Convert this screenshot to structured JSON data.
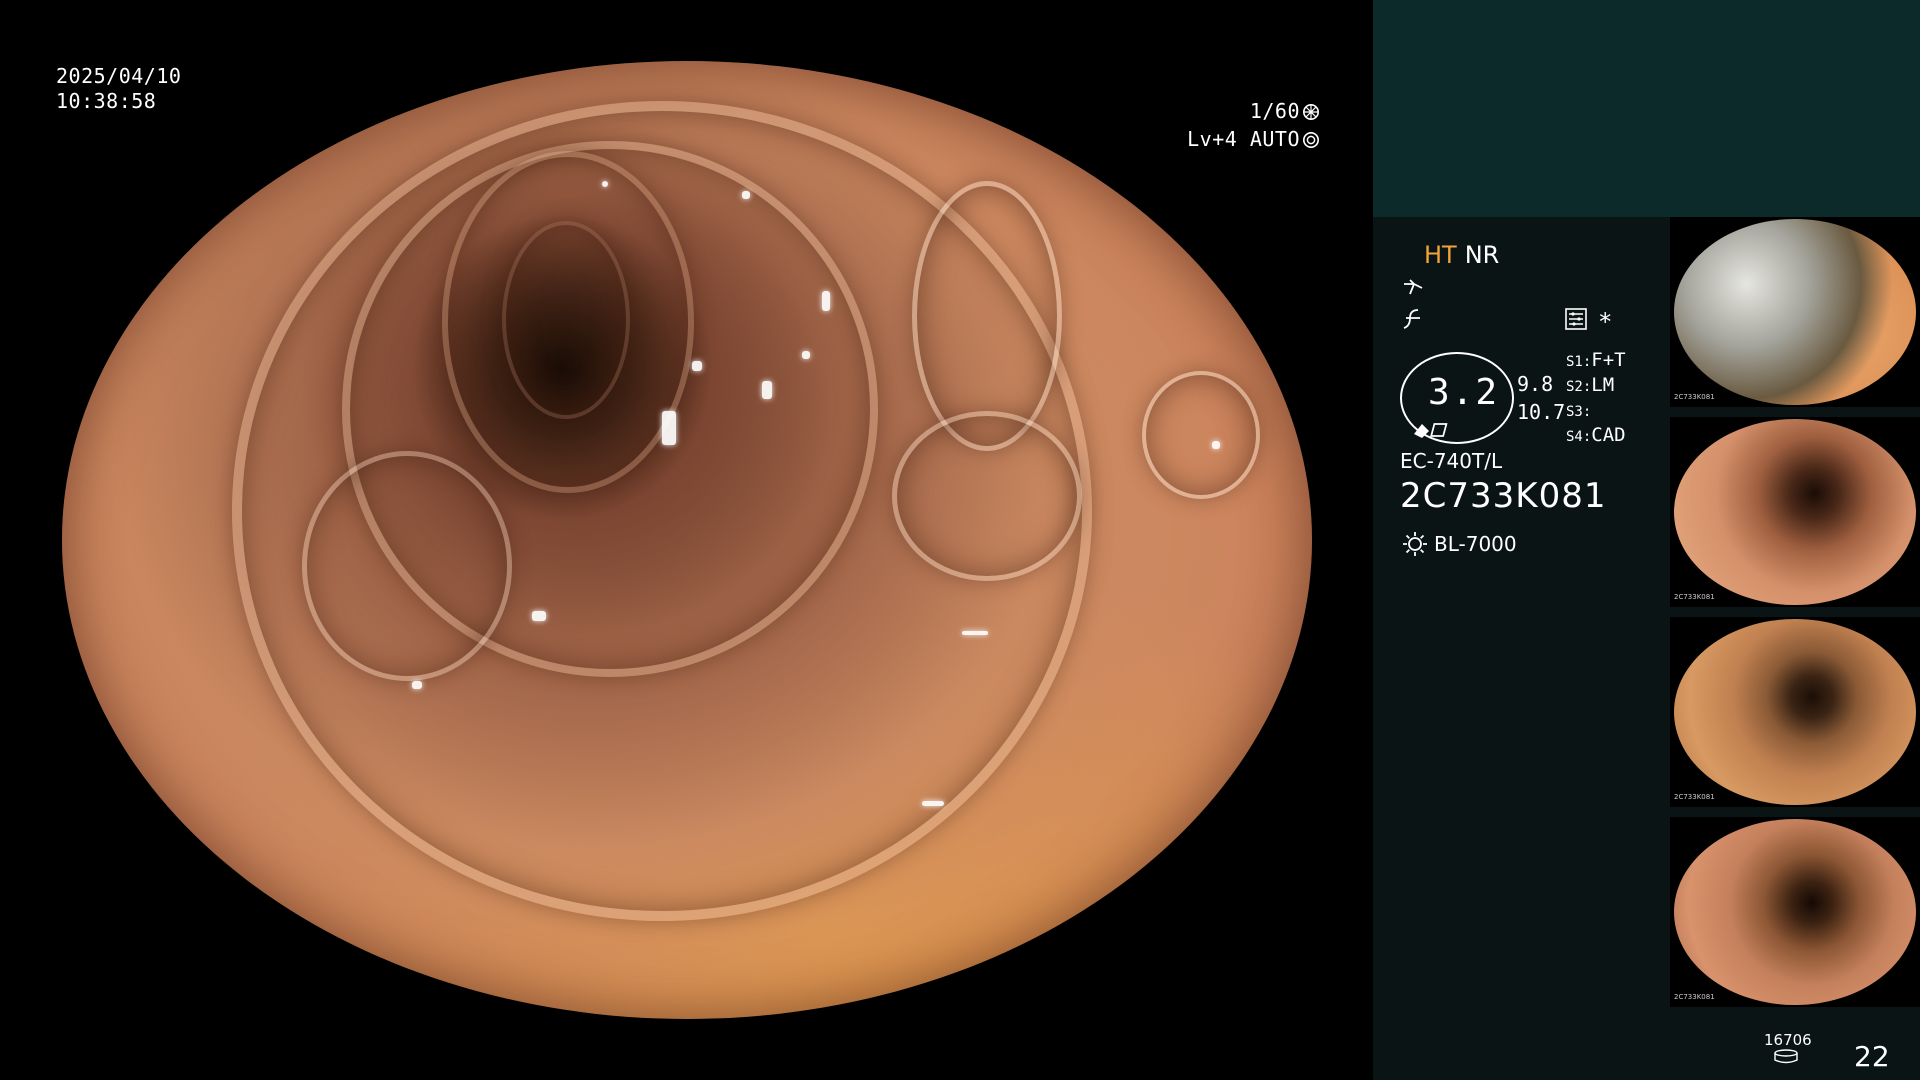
{
  "overlay": {
    "date": "2025/04/10",
    "time": "10:38:58",
    "shutter": "1/60",
    "brightness_level": "Lv+4",
    "iris_mode": "AUTO"
  },
  "panel": {
    "mode_ht": "HT",
    "mode_nr": "NR",
    "magnification": "3.2",
    "mag_a": "9.8",
    "mag_b": "10.7",
    "slots": [
      {
        "key": "S1:",
        "value": "F+T"
      },
      {
        "key": "S2:",
        "value": "LM"
      },
      {
        "key": "S3:",
        "value": ""
      },
      {
        "key": "S4:",
        "value": "CAD"
      }
    ],
    "asterisk": "*",
    "scope_model": "EC-740T/L",
    "scope_serial": "2C733K081",
    "light_source": "BL-7000",
    "capture_count": "16706",
    "frame_number": "22"
  },
  "thumbnails": [
    {
      "id": 1,
      "serial": "2C733K081",
      "index": "21"
    },
    {
      "id": 2,
      "serial": "2C733K081",
      "index": "20"
    },
    {
      "id": 3,
      "serial": "2C733K081",
      "index": "19"
    },
    {
      "id": 4,
      "serial": "2C733K081",
      "index": "18"
    }
  ],
  "colors": {
    "accent_ht": "#f0a43a",
    "panel_bg": "#0a1414",
    "panel_top_bg": "#0d2a2a"
  }
}
